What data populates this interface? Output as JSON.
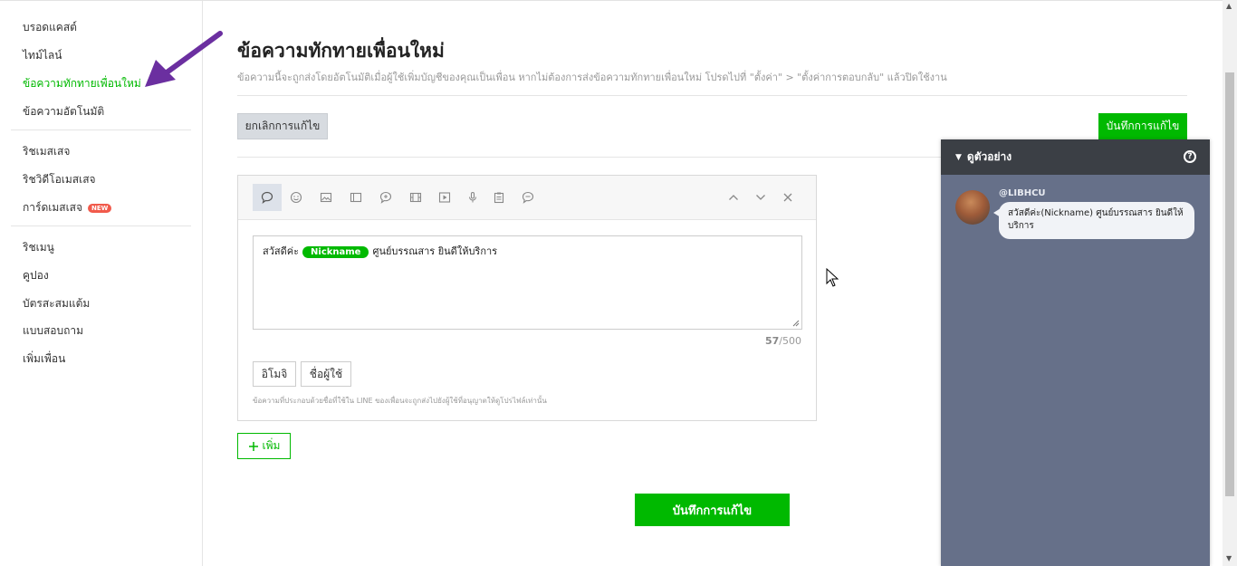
{
  "sidebar": {
    "group1": [
      {
        "label": "บรอดแคสต์"
      },
      {
        "label": "ไทม์ไลน์"
      },
      {
        "label": "ข้อความทักทายเพื่อนใหม่"
      },
      {
        "label": "ข้อความอัตโนมัติ"
      }
    ],
    "group2": [
      {
        "label": "ริชเมสเสจ"
      },
      {
        "label": "ริชวิดีโอเมสเสจ"
      },
      {
        "label": "การ์ดเมสเสจ",
        "badge": "NEW"
      }
    ],
    "group3": [
      {
        "label": "ริชเมนู"
      },
      {
        "label": "คูปอง"
      },
      {
        "label": "บัตรสะสมแต้ม"
      },
      {
        "label": "แบบสอบถาม"
      },
      {
        "label": "เพิ่มเพื่อน"
      }
    ]
  },
  "page": {
    "title": "ข้อความทักทายเพื่อนใหม่",
    "description": "ข้อความนี้จะถูกส่งโดยอัตโนมัติเมื่อผู้ใช้เพิ่มบัญชีของคุณเป็นเพื่อน หากไม่ต้องการส่งข้อความทักทายเพื่อนใหม่ โปรดไปที่ \"ตั้งค่า\" > \"ตั้งค่าการตอบกลับ\" แล้วปิดใช้งาน"
  },
  "actions": {
    "cancel_label": "ยกเลิกการแก้ไข",
    "save_label": "บันทึกการแก้ไข",
    "add_label": "เพิ่ม",
    "save_bottom_label": "บันทึกการแก้ไข"
  },
  "editor": {
    "toolbar_icons": [
      "speech-bubble-icon",
      "emoji-icon",
      "image-icon",
      "card-icon",
      "plus-bubble-icon",
      "video-frame-icon",
      "play-icon",
      "microphone-icon",
      "clipboard-icon",
      "chat-icon"
    ],
    "control_icons": [
      "chevron-up-icon",
      "chevron-down-icon",
      "close-icon"
    ],
    "message_before": "สวัสดีค่ะ",
    "nickname_tag": "Nickname",
    "message_after": "ศูนย์บรรณสาร ยินดีให้บริการ",
    "count_current": "57",
    "count_max": "/500",
    "emoji_button": "อิโมจิ",
    "username_button": "ชื่อผู้ใช้",
    "note": "ข้อความที่ประกอบด้วยชื่อที่ใช้ใน LINE ของเพื่อนจะถูกส่งไปยังผู้ใช้ที่อนุญาตให้ดูโปรไฟล์เท่านั้น"
  },
  "preview": {
    "title": "ดูตัวอย่าง",
    "account_name": "@LIBHCU",
    "bubble_text": "สวัสดีค่ะ(Nickname) ศูนย์บรรณสาร ยินดีให้บริการ"
  },
  "colors": {
    "brand_green": "#00b900",
    "preview_bg": "#667089",
    "preview_header": "#3b3f45",
    "annotation_arrow": "#6b2fa0"
  }
}
